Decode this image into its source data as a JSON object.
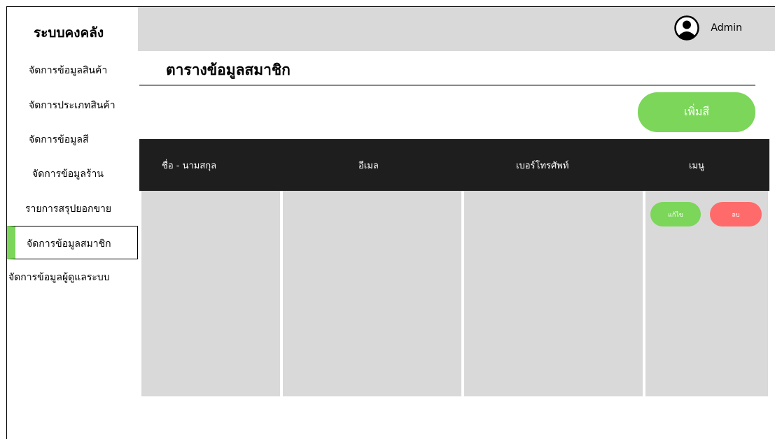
{
  "app": {
    "title": "ระบบคงคลัง"
  },
  "header": {
    "user_label": "Admin",
    "user_icon": "user-circle-icon"
  },
  "sidebar": {
    "items": [
      {
        "label": "จัดการข้อมูลสินค้า",
        "active": false
      },
      {
        "label": "จัดการประเภทสินค้า",
        "active": false
      },
      {
        "label": "จัดการข้อมูลสี",
        "active": false
      },
      {
        "label": "จัดการข้อมูลร้าน",
        "active": false
      },
      {
        "label": "รายการสรุปยอกขาย",
        "active": false
      },
      {
        "label": "จัดการข้อมูลสมาชิก",
        "active": true
      },
      {
        "label": "จัดการข้อมูลผู้ดูแลระบบ",
        "active": false
      }
    ]
  },
  "main": {
    "page_title": "ตารางข้อมูลสมาชิก",
    "add_button_label": "เพิ่มสี",
    "table": {
      "columns": [
        "ชื่อ - นามสกุล",
        "อีเมล",
        "เบอร์โทรศัพท์",
        "เมนู"
      ],
      "row_actions": {
        "edit_label": "แก้ไข",
        "delete_label": "ลบ"
      }
    }
  },
  "colors": {
    "accent_green": "#7bd65a",
    "danger_red": "#ff6b6b",
    "header_dark": "#1e1e1e",
    "panel_gray": "#d9d9d9"
  }
}
